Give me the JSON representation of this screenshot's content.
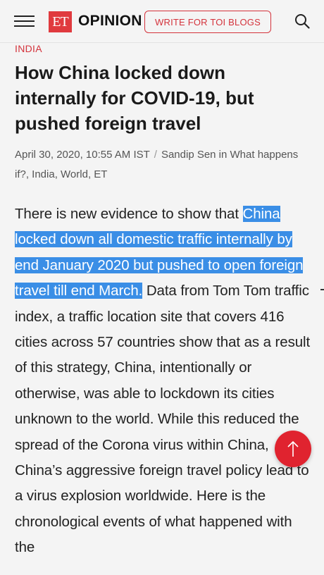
{
  "header": {
    "menu_icon": "hamburger-menu-icon",
    "logo_text": "ET",
    "section_title": "OPINION",
    "write_button_label": "WRITE FOR TOI BLOGS",
    "search_icon": "search-icon",
    "accent_color": "#d4333c"
  },
  "article": {
    "category": "INDIA",
    "headline": "How China locked down internally for COVID-19, but pushed foreign travel",
    "date": "April 30, 2020, 10:55 AM IST",
    "separator": "/",
    "byline": "Sandip Sen in What happens if?, India, World, ET",
    "body_intro": "There is new evidence to show that ",
    "body_highlight": "China locked down all domestic traffic internally by end January 2020 but pushed to open foreign travel till end March.",
    "body_rest": " Data from Tom Tom traffic index, a traffic location site that covers 416 cities across 57 countries show that as a result of this strategy, China, intentionally or otherwise, was able to lockdown its cities unknown to the world. While this reduced the spread of the Corona virus within China, China’s aggressive foreign travel policy lead to a virus explosion worldwide. Here is the chronological events of what happened with the",
    "highlight_color": "#3a8ee6"
  },
  "scroll_top_button": {
    "icon": "arrow-up-icon",
    "color": "#e0232f"
  }
}
